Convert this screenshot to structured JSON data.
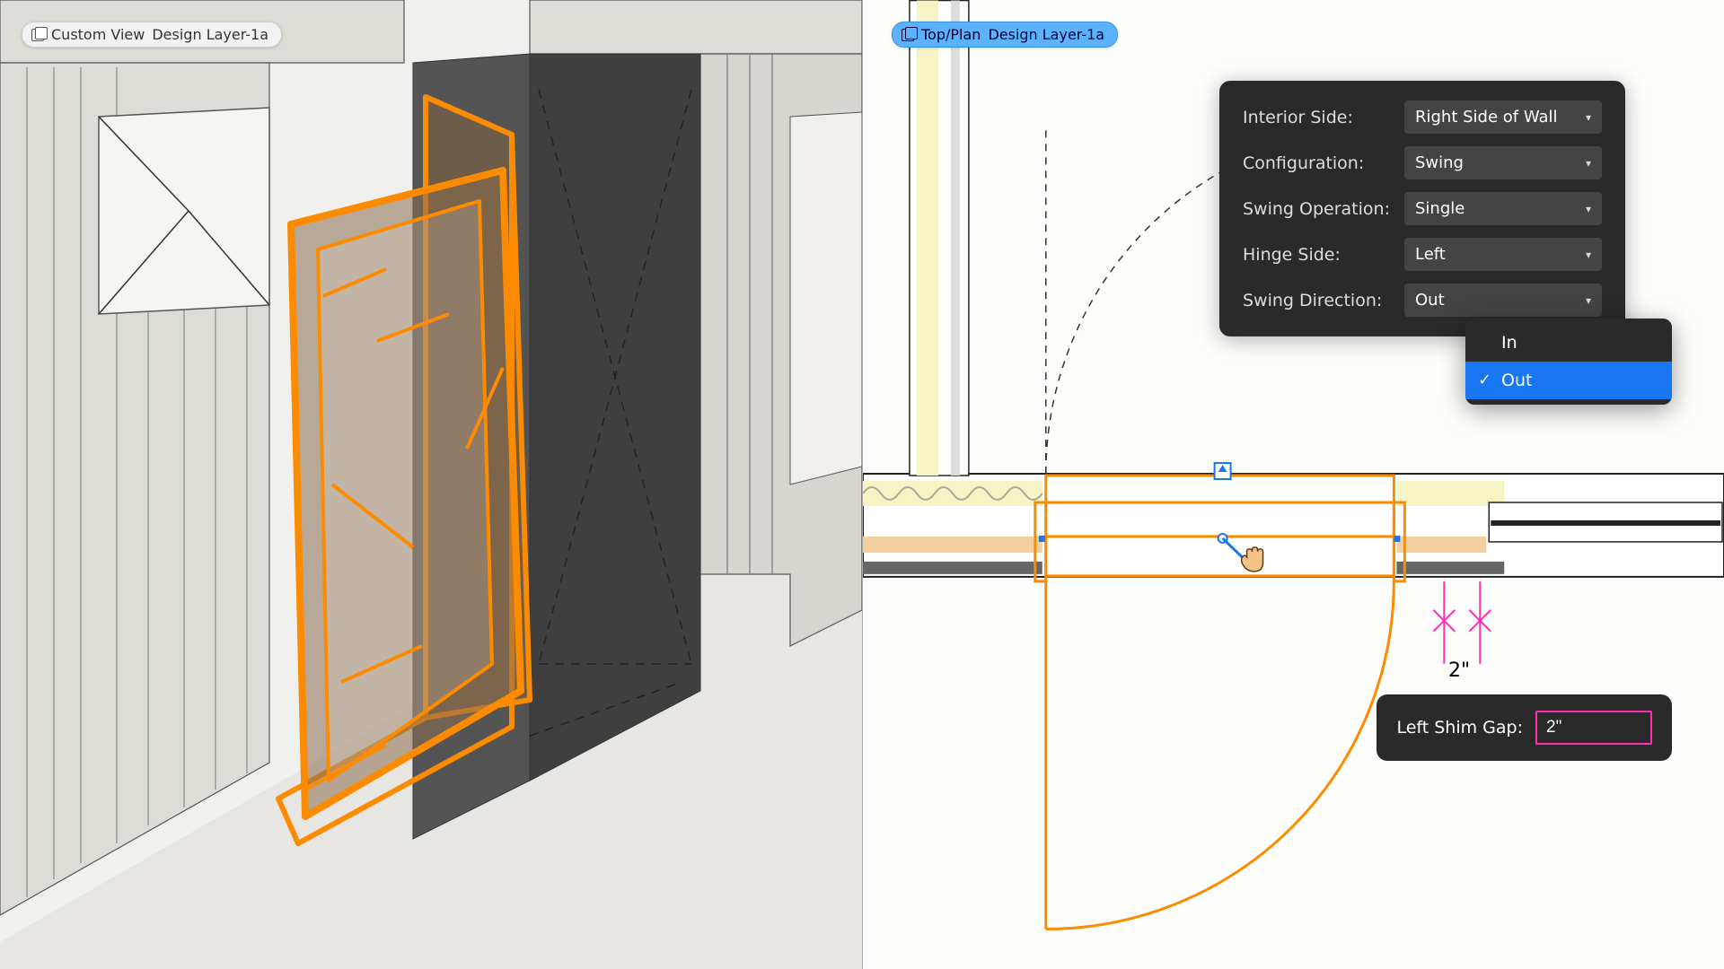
{
  "left_viewport": {
    "view_name": "Custom View",
    "layer": "Design Layer-1a"
  },
  "right_viewport": {
    "view_name": "Top/Plan",
    "layer": "Design Layer-1a"
  },
  "properties": {
    "interior_side": {
      "label": "Interior Side:",
      "value": "Right Side of Wall"
    },
    "configuration": {
      "label": "Configuration:",
      "value": "Swing"
    },
    "swing_operation": {
      "label": "Swing Operation:",
      "value": "Single"
    },
    "hinge_side": {
      "label": "Hinge Side:",
      "value": "Left"
    },
    "swing_direction": {
      "label": "Swing Direction:",
      "value": "Out"
    }
  },
  "swing_direction_options": {
    "opt1": "In",
    "opt2": "Out"
  },
  "shim_gap": {
    "label": "Left Shim Gap:",
    "value": "2\""
  },
  "dimension": {
    "value": "2\""
  },
  "colors": {
    "highlight": "#fd8b00",
    "magenta": "#ff2db0",
    "blue_ui": "#1976f2",
    "badge_blue": "#5bb3ff"
  }
}
